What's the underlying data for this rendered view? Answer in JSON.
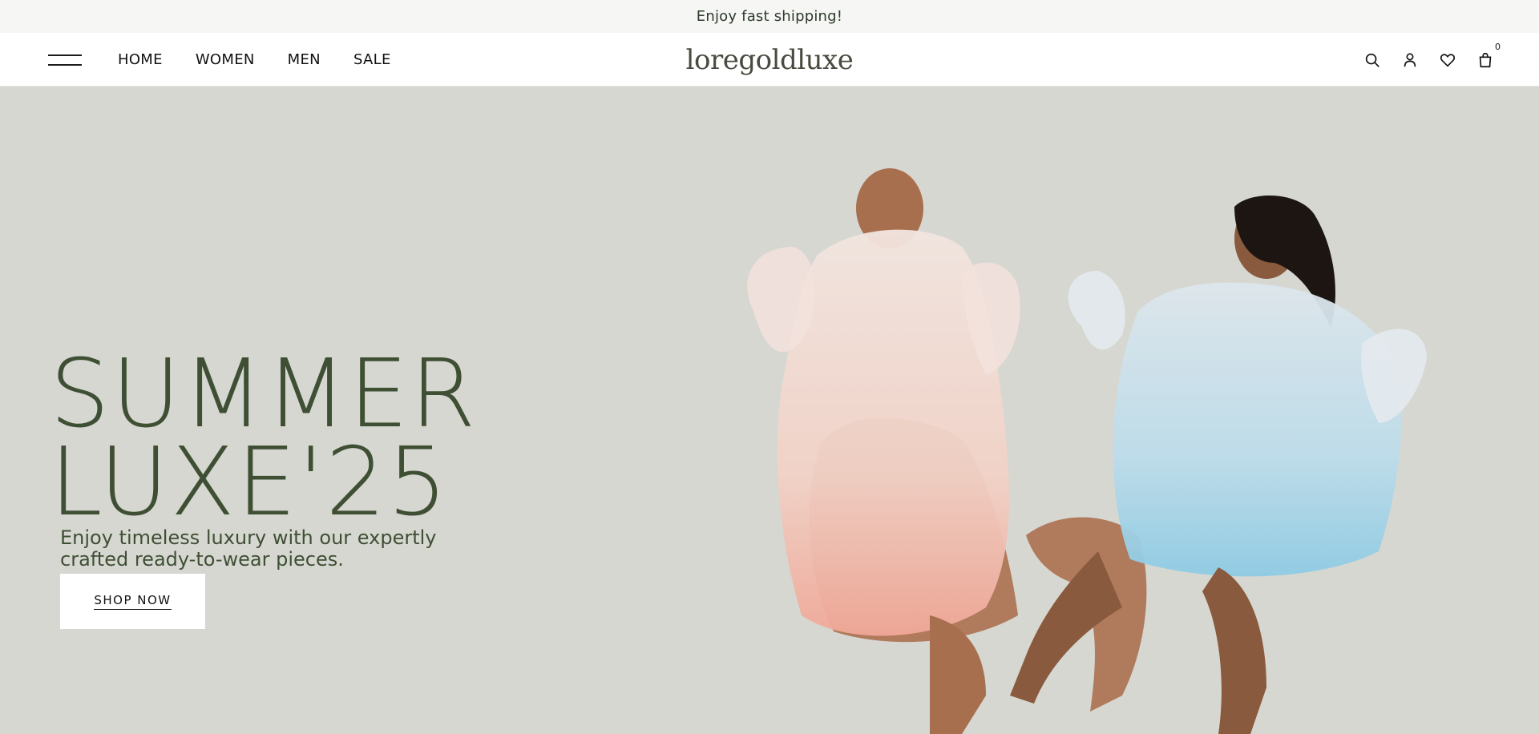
{
  "announcement": {
    "text": "Enjoy fast shipping!"
  },
  "header": {
    "brand": "loregoldluxe",
    "nav": [
      {
        "label": "HOME"
      },
      {
        "label": "WOMEN"
      },
      {
        "label": "MEN"
      },
      {
        "label": "SALE"
      }
    ],
    "icons": [
      "search-icon",
      "account-icon",
      "heart-icon",
      "bag-icon"
    ],
    "cart_count": "0"
  },
  "hero": {
    "headline_line1": "SUMMER",
    "headline_line2": "LUXE'25",
    "subtext_line1": "Enjoy timeless luxury with our expertly",
    "subtext_line2": "crafted ready-to-wear pieces.",
    "cta": "SHOP NOW",
    "image": "two models in sheer dresses, pink and light blue"
  },
  "colors": {
    "hero_bg": "#d6d7d1",
    "headline": "#3f4f34",
    "announce_bg": "#f6f6f5",
    "dress_pink": "#f1c4b8",
    "dress_blue": "#a9d3e6"
  }
}
